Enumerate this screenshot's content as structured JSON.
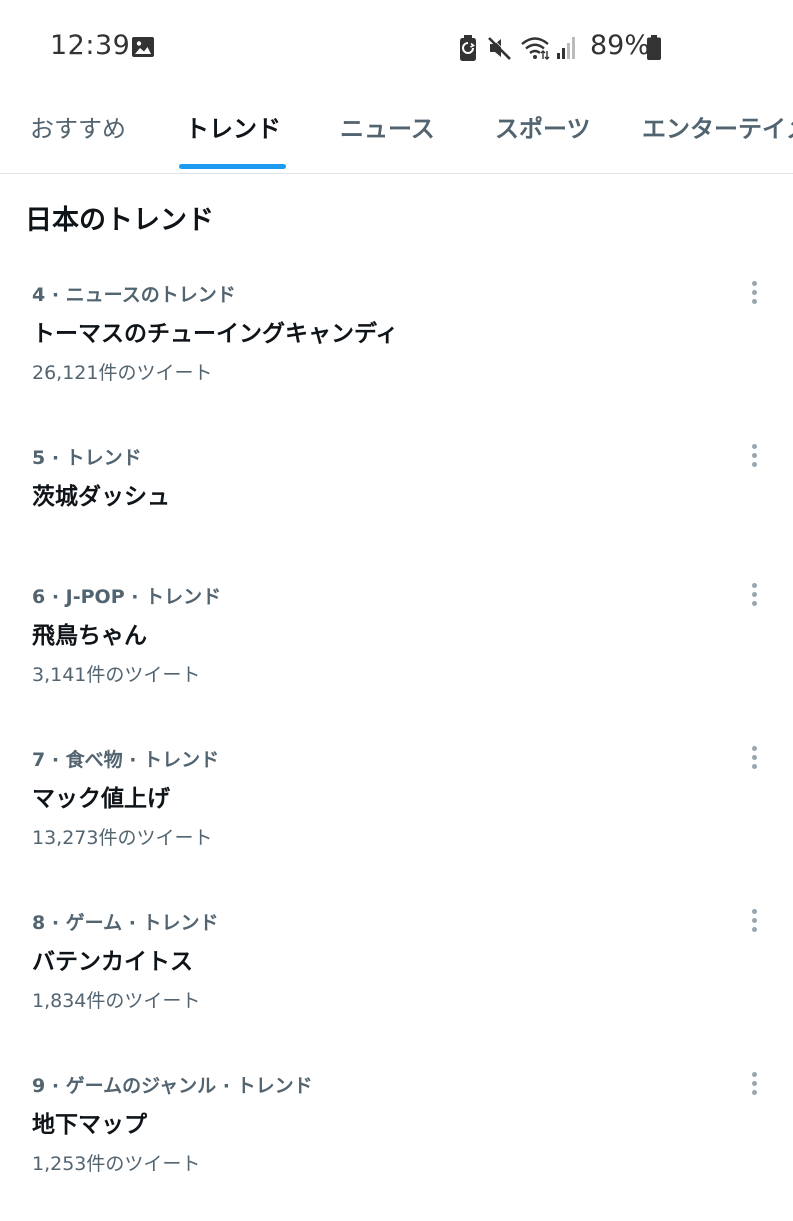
{
  "status_bar": {
    "time": "12:39",
    "battery_percent": "89%",
    "icons": [
      "gallery-icon",
      "battery-saver-icon",
      "mute-icon",
      "wifi-icon",
      "signal-icon",
      "battery-icon"
    ]
  },
  "tabs": [
    {
      "label": "おすすめ",
      "active": false
    },
    {
      "label": "トレンド",
      "active": true
    },
    {
      "label": "ニュース",
      "active": false
    },
    {
      "label": "スポーツ",
      "active": false
    },
    {
      "label": "エンターテイメ",
      "active": false
    }
  ],
  "section_title": "日本のトレンド",
  "trends": [
    {
      "meta": "4 · ニュースのトレンド",
      "name": "トーマスのチューイングキャンディ",
      "count": "26,121件のツイート"
    },
    {
      "meta": "5 · トレンド",
      "name": "茨城ダッシュ",
      "count": ""
    },
    {
      "meta": "6 · J-POP · トレンド",
      "name": "飛鳥ちゃん",
      "count": "3,141件のツイート"
    },
    {
      "meta": "7 · 食べ物 · トレンド",
      "name": "マック値上げ",
      "count": "13,273件のツイート"
    },
    {
      "meta": "8 · ゲーム · トレンド",
      "name": "バテンカイトス",
      "count": "1,834件のツイート"
    },
    {
      "meta": "9 · ゲームのジャンル · トレンド",
      "name": "地下マップ",
      "count": "1,253件のツイート"
    }
  ],
  "colors": {
    "accent": "#1d9bf0",
    "text_primary": "#0f1419",
    "text_secondary": "#536471"
  }
}
